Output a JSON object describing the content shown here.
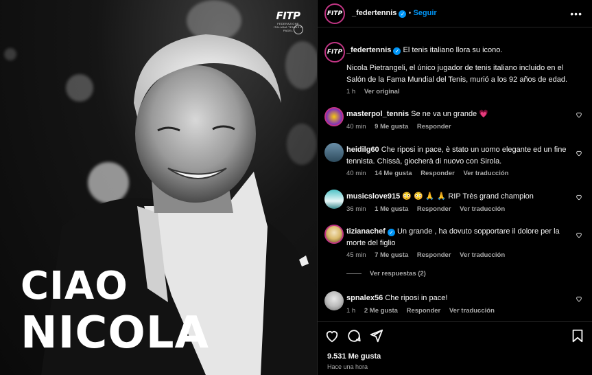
{
  "media": {
    "logo_text": "FITP",
    "logo_subtext": "FEDERAZIONE ITALIANA TENNIS E PADEL",
    "headline_line1": "CIAO",
    "headline_line2": "NICOLA"
  },
  "header": {
    "username": "_federtennis",
    "separator": "•",
    "follow_label": "Seguir",
    "more_icon": "more-horizontal-icon"
  },
  "caption": {
    "username": "_federtennis",
    "title": "El tenis italiano llora su icono.",
    "body": "Nicola Pietrangeli, el único jugador de tenis italiano incluido en el Salón de la Fama Mundial del Tenis, murió a los 92 años de edad.",
    "time": "1 h",
    "see_original": "Ver original"
  },
  "comments": [
    {
      "username": "masterpol_tennis",
      "text": "Se ne va un grande 💗",
      "time": "40 min",
      "likes": "9 Me gusta",
      "reply": "Responder",
      "translate": ""
    },
    {
      "username": "heidilg60",
      "text": "Che riposi in pace, è stato un uomo elegante ed un fine tennista. Chissà, giocherà di nuovo con Sirola.",
      "time": "40 min",
      "likes": "14 Me gusta",
      "reply": "Responder",
      "translate": "Ver traducción"
    },
    {
      "username": "musicslove915",
      "text": "😳 😳 🙏 🙏 RIP Très grand champion",
      "time": "36 min",
      "likes": "1 Me gusta",
      "reply": "Responder",
      "translate": "Ver traducción"
    },
    {
      "username": "tizianachef",
      "text": "Un grande , ha dovuto sopportare il dolore per la morte del figlio",
      "time": "45 min",
      "likes": "7 Me gusta",
      "reply": "Responder",
      "translate": "Ver traducción"
    },
    {
      "username": "spnalex56",
      "text": "Che riposi in pace!",
      "time": "1 h",
      "likes": "2 Me gusta",
      "reply": "Responder",
      "translate": "Ver traducción"
    }
  ],
  "replies_label": "Ver respuestas (2)",
  "footer": {
    "likes": "9.531 Me gusta",
    "posted": "Hace una hora"
  },
  "colors": {
    "accent": "#0095f6",
    "background": "#000000",
    "muted": "#a8a8a8",
    "border": "#262626"
  }
}
